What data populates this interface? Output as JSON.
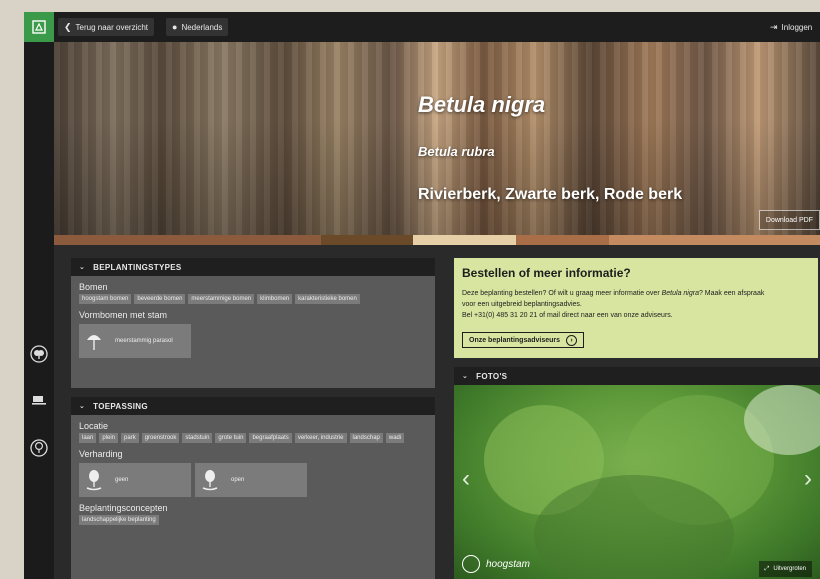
{
  "topbar": {
    "back_label": "Terug naar overzicht",
    "language_label": "Nederlands",
    "login_label": "Inloggen"
  },
  "hero": {
    "title": "Betula nigra",
    "synonym": "Betula rubra",
    "common_names": "Rivierberk, Zwarte berk, Rode berk",
    "pdf_label": "Download PDF"
  },
  "colors": [
    "#8c5a3c",
    "#6b4a2a",
    "#e6cfa6",
    "#a86e48",
    "#c48a60"
  ],
  "beplantingstypes": {
    "heading": "BEPLANTINGSTYPES",
    "group1_label": "Bomen",
    "group1_tags": [
      "hoogstam bomen",
      "beveerde bomen",
      "meerstammige bomen",
      "klimbomen",
      "karakteristieke bomen"
    ],
    "group2_label": "Vormbomen met stam",
    "card_label": "meerstammig parasol"
  },
  "toepassing": {
    "heading": "TOEPASSING",
    "locatie_label": "Locatie",
    "locatie_tags": [
      "laan",
      "plein",
      "park",
      "groenstrook",
      "stadstuin",
      "grote tuin",
      "begraafplaats",
      "verkeer, industrie",
      "landschap",
      "wadi"
    ],
    "verharding_label": "Verharding",
    "card1_label": "geen",
    "card2_label": "open",
    "concepten_label": "Beplantingsconcepten",
    "concepten_tags": [
      "landschappelijke beplanting"
    ]
  },
  "order": {
    "title": "Bestellen of meer informatie?",
    "line1_a": "Deze beplanting bestellen? Of wilt u graag meer informatie over ",
    "line1_species": "Betula nigra",
    "line1_b": "? Maak een afspraak",
    "line2": "voor een uitgebreid beplantingsadvies.",
    "line3": "Bel +31(0) 485 31 20 21 of mail direct naar een van onze adviseurs.",
    "button_label": "Onze beplantingsadviseurs",
    "button_arrow": "›"
  },
  "photos": {
    "heading": "FOTO'S",
    "caption": "hoogstam",
    "enlarge_label": "Uitvergroten",
    "prev_arrow": "‹",
    "next_arrow": "›"
  }
}
